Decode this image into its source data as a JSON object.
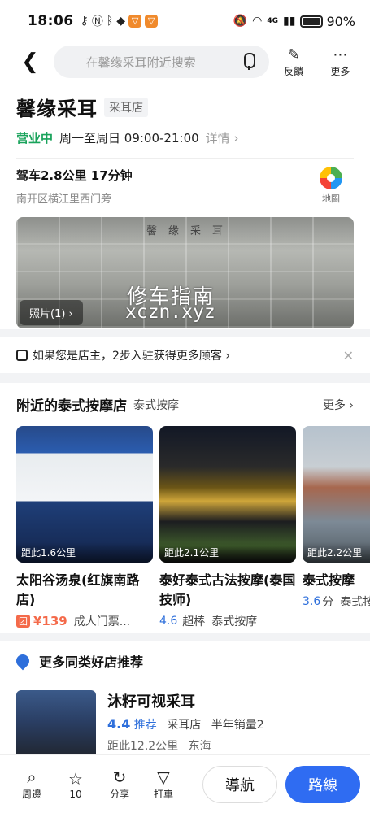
{
  "status_bar": {
    "time": "18:06",
    "signal_labels": "4G",
    "battery_percent": "90%",
    "battery_level": 0.9
  },
  "nav": {
    "search_placeholder": "在馨缘采耳附近搜索",
    "feedback_label": "反饋",
    "more_label": "更多"
  },
  "place": {
    "name": "馨缘采耳",
    "category_tag": "采耳店",
    "status": "营业中",
    "hours": "周一至周日 09:00-21:00",
    "detail_label": "详情",
    "drive": "驾车2.8公里 17分钟",
    "address": "南开区横江里西门旁",
    "map_label": "地圖",
    "photo": {
      "sign_text": "馨缘采耳",
      "watermark_cn": "修车指南",
      "watermark_url": "xczn.xyz",
      "count_label": "照片(1)"
    }
  },
  "owner_banner": {
    "text": "如果您是店主，2步入驻获得更多顾客"
  },
  "nearby": {
    "title": "附近的泰式按摩店",
    "subtitle": "泰式按摩",
    "more_label": "更多",
    "items": [
      {
        "distance": "距此1.6公里",
        "name": "太阳谷汤泉(红旗南路店)",
        "tuan": "团",
        "price": "¥139",
        "tag": "成人门票..."
      },
      {
        "distance": "距此2.1公里",
        "name": "泰好泰式古法按摩(泰国技师)",
        "score": "4.6",
        "rating_word": "超棒",
        "tag": "泰式按摩"
      },
      {
        "distance": "距此2.2公里",
        "name": "泰式按摩",
        "score": "3.6",
        "rating_word": "分",
        "tag": "泰式按"
      }
    ]
  },
  "recommend": {
    "title": "更多同类好店推荐",
    "item": {
      "name": "沐籽可视采耳",
      "score": "4.4",
      "score_word": "推荐",
      "category": "采耳店",
      "sales": "半年销量2",
      "distance": "距此12.2公里",
      "area": "东海"
    }
  },
  "bottom_bar": {
    "tabs": [
      {
        "icon": "search-icon",
        "label": "周邊"
      },
      {
        "icon": "star-icon",
        "label": "10"
      },
      {
        "icon": "share-icon",
        "label": "分享"
      },
      {
        "icon": "taxi-icon",
        "label": "打車"
      }
    ],
    "navigate_label": "導航",
    "route_label": "路線"
  },
  "colors": {
    "accent_blue": "#2f6cf2",
    "open_green": "#19a35b",
    "price_red": "#f46a4a"
  }
}
